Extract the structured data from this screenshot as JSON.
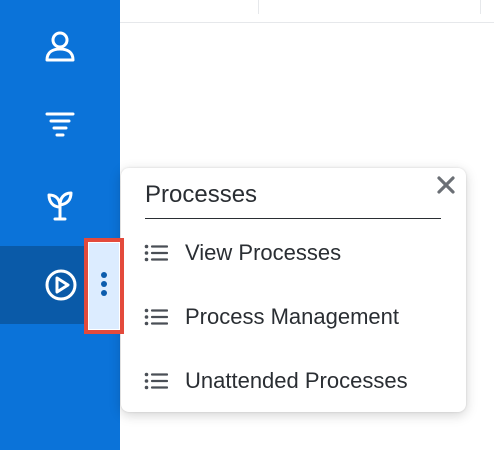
{
  "colors": {
    "sidebar_bg": "#0b73d9",
    "sidebar_active_bg": "#0a5aa8",
    "highlight_border": "#e34a3c",
    "kebab_bg": "#dcecff",
    "text": "#2a2e33"
  },
  "sidebar": {
    "items": [
      {
        "icon": "user-icon"
      },
      {
        "icon": "funnel-icon"
      },
      {
        "icon": "sprout-icon"
      },
      {
        "icon": "play-circle-icon",
        "active": true
      }
    ],
    "more_icon": "kebab-vertical-icon"
  },
  "popover": {
    "title": "Processes",
    "close_icon": "close-icon",
    "items": [
      {
        "label": "View Processes",
        "icon": "list-icon"
      },
      {
        "label": "Process Management",
        "icon": "list-icon"
      },
      {
        "label": "Unattended Processes",
        "icon": "list-icon"
      }
    ]
  }
}
